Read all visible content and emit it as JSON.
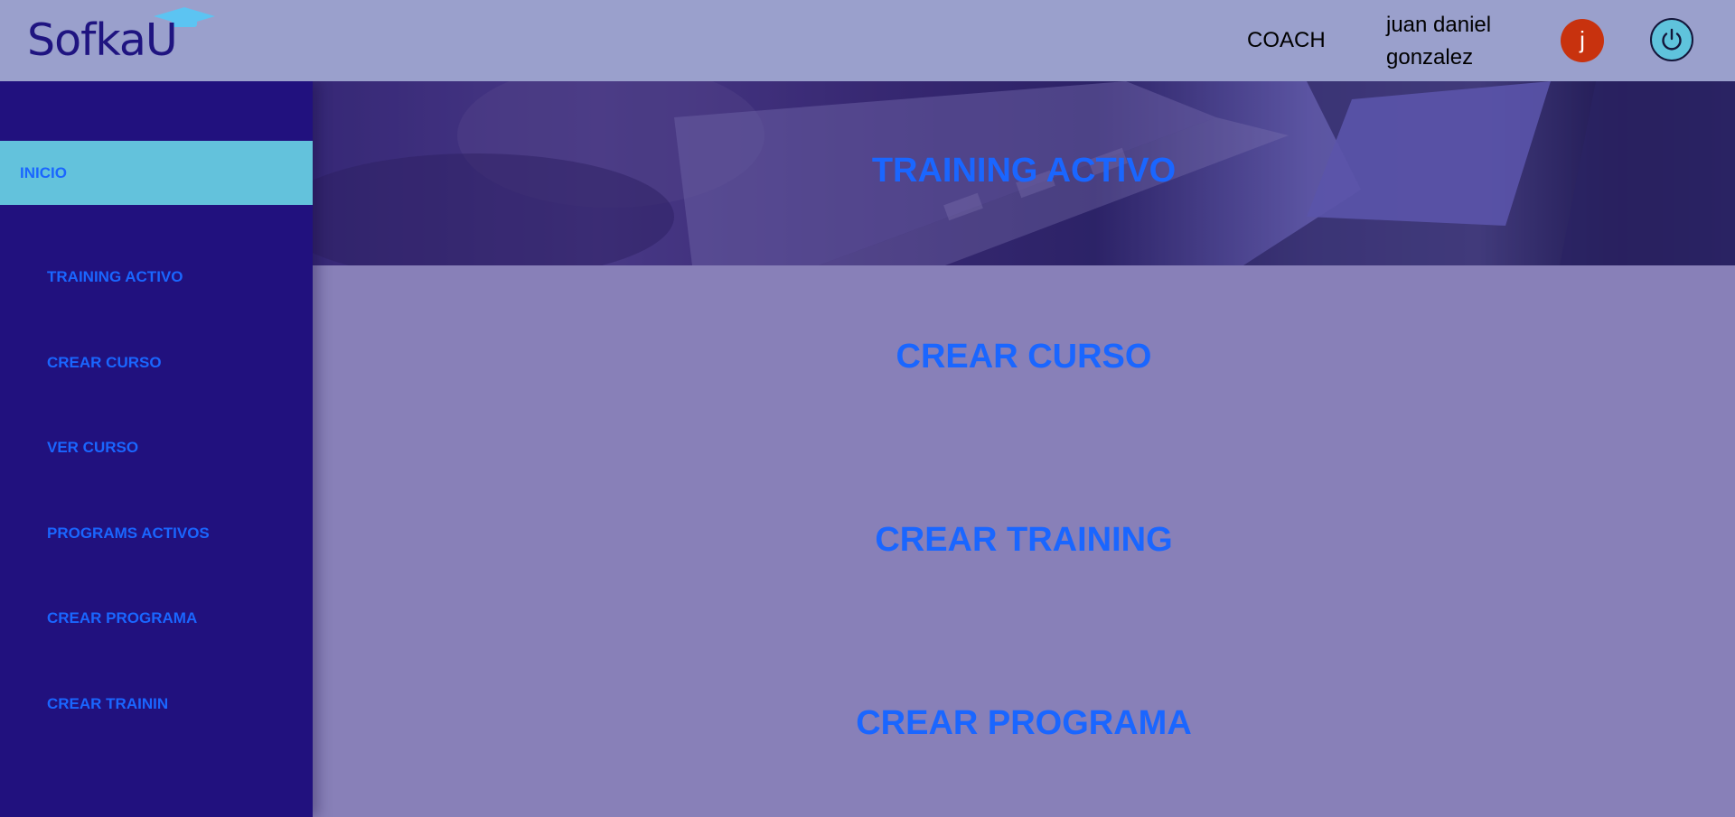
{
  "header": {
    "logo_text": "SofkaU",
    "role": "COACH",
    "user_name": "juan daniel gonzalez",
    "avatar_initial": "j",
    "power_icon": "power-icon",
    "colors": {
      "header_bg": "#9aa0cc",
      "avatar_bg": "#c8320e",
      "power_bg": "#5fc3dc",
      "logo": "#1f1480"
    }
  },
  "sidebar": {
    "home_label": "INICIO",
    "items": [
      {
        "label": "TRAINING ACTIVO"
      },
      {
        "label": "CREAR CURSO"
      },
      {
        "label": "VER CURSO"
      },
      {
        "label": "PROGRAMS ACTIVOS"
      },
      {
        "label": "CREAR PROGRAMA"
      },
      {
        "label": "CREAR TRAININ"
      }
    ],
    "colors": {
      "bg": "#21117e",
      "active_bg": "#63c2dc",
      "text": "#1a66ff"
    }
  },
  "main": {
    "hero_title": "TRAINING ACTIVO",
    "sections": [
      {
        "label": "CREAR CURSO"
      },
      {
        "label": "CREAR TRAINING"
      },
      {
        "label": "CREAR PROGRAMA"
      }
    ],
    "colors": {
      "bg": "#8880b8",
      "text": "#1a66ff"
    }
  }
}
